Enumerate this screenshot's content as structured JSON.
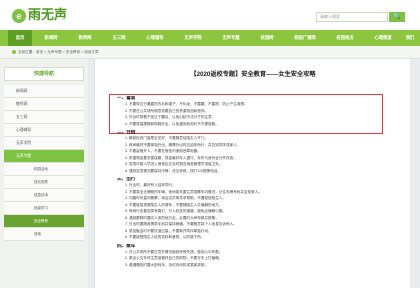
{
  "header": {
    "logo_mark": "e",
    "logo_text": "雨无声",
    "logo_sub": "网",
    "search_placeholder": "请输入搜索",
    "search_button": "🔍"
  },
  "nav": [
    {
      "label": "首页"
    },
    {
      "label": "新闻网"
    },
    {
      "label": "教师网"
    },
    {
      "label": "五三网"
    },
    {
      "label": "心理辅导"
    },
    {
      "label": "无声学院"
    },
    {
      "label": "无声专题"
    },
    {
      "label": "校园网"
    },
    {
      "label": "校园广播网"
    },
    {
      "label": "校园视点"
    },
    {
      "label": "心理频道"
    },
    {
      "label": "我们"
    }
  ],
  "breadcrumb": "当前位置：首页 > 无声专题 > 安全教育 > 阅读文章",
  "sidebar": {
    "heading": "快捷导航",
    "items": [
      {
        "label": "新闻网"
      },
      {
        "label": "教师网"
      },
      {
        "label": "五三网"
      },
      {
        "label": "心理辅导"
      },
      {
        "label": "无声学院"
      },
      {
        "label": "无声专题"
      },
      {
        "label": "校园活动"
      },
      {
        "label": "成长指导"
      },
      {
        "label": "信息技术"
      },
      {
        "label": "班级学习"
      },
      {
        "label": "安全教育"
      },
      {
        "label": "其他"
      }
    ]
  },
  "article": {
    "title": "【2020返校专题】安全教育——女生安全攻略",
    "lines": [
      {
        "text": "一、着装",
        "kind": "h"
      },
      {
        "text": "1. 不要穿过分暴露的衣衫和裙子，不化妆、不露腰、不露脐，防止产生误想。",
        "kind": "in"
      },
      {
        "text": "2. 不要在公共场所随意炫耀自己的贵重物品和首饰。",
        "kind": "in"
      },
      {
        "text": "3. 外出时穿着不宜过于醒目，以免引起不法分子的注意。",
        "kind": "in"
      },
      {
        "text": "4. 不要穿高跟鞋和拖鞋外出，以免遇到危险时不方便逃跑。",
        "kind": "in"
      },
      {
        "text": "二、住宿",
        "kind": "h"
      },
      {
        "text": "1. 睡前检查门窗是否关好，不要随意给陌生人开门。",
        "kind": "in"
      },
      {
        "text": "2. 夜间最好不要单独外出，确需外出时应结伴而行，并告知同学或家人。",
        "kind": "in"
      },
      {
        "text": "3. 不要留宿外人，不要在宿舍内使用违章电器。",
        "kind": "in"
      },
      {
        "text": "4. 贵重物品要妥善保管，现金最好存入银行，存折与身份证分开存放。",
        "kind": "in"
      },
      {
        "text": "5. 发现可疑人员进入宿舍区应及时报告宿舍管理员或保卫处。",
        "kind": "in"
      },
      {
        "text": "6. 遇到突发情况要保持冷静，设法求救，拨打110报警电话。",
        "kind": "in"
      },
      {
        "text": "三、出行",
        "kind": "h"
      },
      {
        "text": "1. 外出时，最好有人结伴同行。",
        "kind": "in"
      },
      {
        "text": "2. 不要乘坐无牌照的车辆，夜间乘车要注意观察车内情况，记住车牌号码并告知家人。",
        "kind": "in"
      },
      {
        "text": "3. 问路时尽量向警察、商店店员等寻求帮助，不要轻信陌生人。",
        "kind": "in"
      },
      {
        "text": "4. 不要轻易搭乘陌生人的便车，不要随陌生人去偏僻的地方。",
        "kind": "in"
      },
      {
        "text": "5. 夜间行走要选择有路灯、行人较多的道路，避免走偏僻小路。",
        "kind": "in"
      },
      {
        "text": "6. 遇到跟踪时要向人多的地方走，必要时大声呼救并报警。",
        "kind": "in"
      },
      {
        "text": "7. 外出时要随身携带手机并保持畅通，不要随意将个人信息告诉他人。",
        "kind": "in"
      },
      {
        "text": "8. 参加聚会时不要饮酒过量，不要离开同伴单独行动。",
        "kind": "in"
      },
      {
        "text": "9. 不要接受陌生人给的饮料和食物，以防被下药。",
        "kind": "in"
      },
      {
        "text": "四、乘车",
        "kind": "h"
      },
      {
        "text": "1. 在公共场所不要在意外情况面前惊慌失措，做到心中有数。",
        "kind": "in"
      },
      {
        "text": "2. 乘坐公交车时注意保管好自己的财物，不要在车上打瞌睡。",
        "kind": "in"
      },
      {
        "text": "3. 遭遇骚扰时要大胆呵斥，及时向司机或乘客求助。",
        "kind": "in"
      }
    ]
  }
}
